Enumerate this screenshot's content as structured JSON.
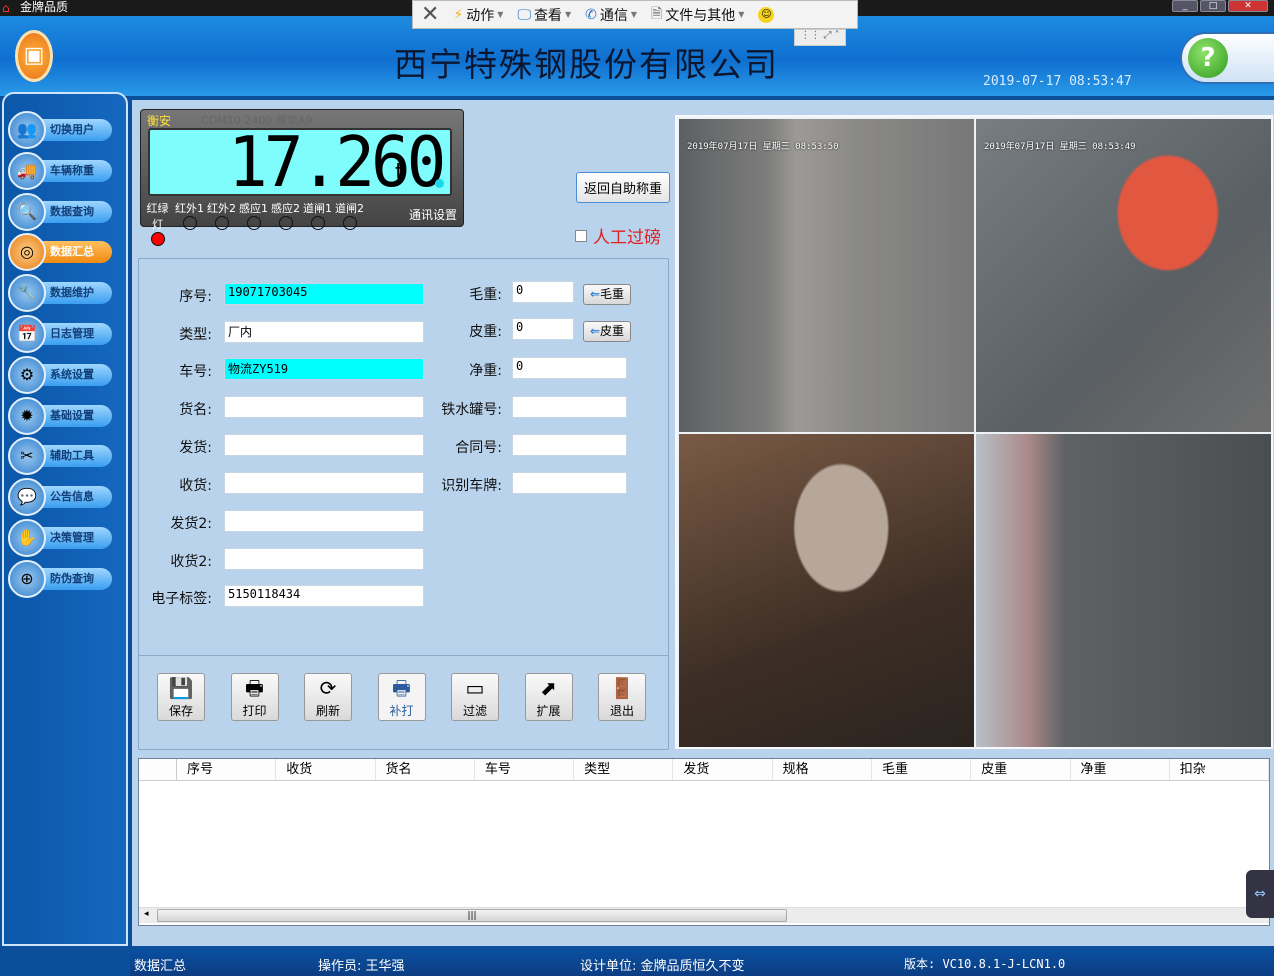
{
  "window": {
    "title": "金牌品质"
  },
  "remote_toolbar": {
    "items": [
      {
        "label": "动作",
        "icon": "lightning-icon"
      },
      {
        "label": "查看",
        "icon": "monitor-icon"
      },
      {
        "label": "通信",
        "icon": "phone-icon"
      },
      {
        "label": "文件与其他",
        "icon": "file-icon"
      }
    ]
  },
  "header": {
    "company": "西宁特殊钢股份有限公司",
    "datetime": "2019-07-17 08:53:47"
  },
  "sidebar": {
    "items": [
      {
        "label": "切换用户",
        "icon": "users-icon"
      },
      {
        "label": "车辆称重",
        "icon": "truck-icon"
      },
      {
        "label": "数据查询",
        "icon": "magnifier-icon"
      },
      {
        "label": "数据汇总",
        "icon": "database-icon",
        "active": true
      },
      {
        "label": "数据维护",
        "icon": "wrench-icon"
      },
      {
        "label": "日志管理",
        "icon": "calendar-icon"
      },
      {
        "label": "系统设置",
        "icon": "gear-icon"
      },
      {
        "label": "基础设置",
        "icon": "chip-icon"
      },
      {
        "label": "辅助工具",
        "icon": "tools-icon"
      },
      {
        "label": "公告信息",
        "icon": "chat-icon"
      },
      {
        "label": "决策管理",
        "icon": "decision-icon"
      },
      {
        "label": "防伪查询",
        "icon": "anticounterfeit-icon"
      }
    ]
  },
  "scale": {
    "brand": "衡安",
    "port_info": "COM10 2400 耀华A9",
    "value": "17.260",
    "unit": "t",
    "comm_settings": "通讯设置",
    "signals": [
      {
        "label": "红绿灯",
        "on": true,
        "color": "#ff0000"
      },
      {
        "label": "红外1",
        "on": false
      },
      {
        "label": "红外2",
        "on": false
      },
      {
        "label": "感应1",
        "on": false
      },
      {
        "label": "感应2",
        "on": false
      },
      {
        "label": "道闸1",
        "on": false
      },
      {
        "label": "道闸2",
        "on": false
      }
    ]
  },
  "return_button": "返回自助称重",
  "manual_weigh": {
    "label": "人工过磅",
    "checked": false
  },
  "form": {
    "serial": {
      "label": "序号:",
      "value": "19071703045"
    },
    "type": {
      "label": "类型:",
      "value": "厂内"
    },
    "vehicle": {
      "label": "车号:",
      "value": "物流ZY519"
    },
    "goods": {
      "label": "货名:",
      "value": ""
    },
    "sender": {
      "label": "发货:",
      "value": ""
    },
    "receiver": {
      "label": "收货:",
      "value": ""
    },
    "sender2": {
      "label": "发货2:",
      "value": ""
    },
    "receiver2": {
      "label": "收货2:",
      "value": ""
    },
    "rfid": {
      "label": "电子标签:",
      "value": "5150118434"
    },
    "gross": {
      "label": "毛重:",
      "value": "0",
      "button": "毛重"
    },
    "tare": {
      "label": "皮重:",
      "value": "0",
      "button": "皮重"
    },
    "net": {
      "label": "净重:",
      "value": "0"
    },
    "tank_no": {
      "label": "铁水罐号:",
      "value": ""
    },
    "contract": {
      "label": "合同号:",
      "value": ""
    },
    "plate_recog": {
      "label": "识别车牌:",
      "value": ""
    }
  },
  "actions": [
    {
      "label": "保存",
      "icon": "floppy-icon"
    },
    {
      "label": "打印",
      "icon": "printer-icon"
    },
    {
      "label": "刷新",
      "icon": "refresh-icon"
    },
    {
      "label": "补打",
      "icon": "reprint-icon",
      "disabled": true
    },
    {
      "label": "过滤",
      "icon": "filter-icon"
    },
    {
      "label": "扩展",
      "icon": "expand-icon"
    },
    {
      "label": "退出",
      "icon": "exit-door-icon"
    }
  ],
  "cameras": [
    {
      "timestamp": "2019年07月17日 星期三 08:53:50"
    },
    {
      "timestamp": "2019年07月17日 星期三 08:53:49"
    },
    {
      "timestamp": ""
    },
    {
      "timestamp": ""
    }
  ],
  "table": {
    "columns": [
      "序号",
      "收货",
      "货名",
      "车号",
      "类型",
      "发货",
      "规格",
      "毛重",
      "皮重",
      "净重",
      "扣杂"
    ],
    "rows": []
  },
  "statusbar": {
    "module": "数据汇总",
    "operator": "操作员: 王华强",
    "designer": "设计单位: 金牌品质恒久不变",
    "version": "版本: VC10.8.1-J-LCN1.0"
  }
}
